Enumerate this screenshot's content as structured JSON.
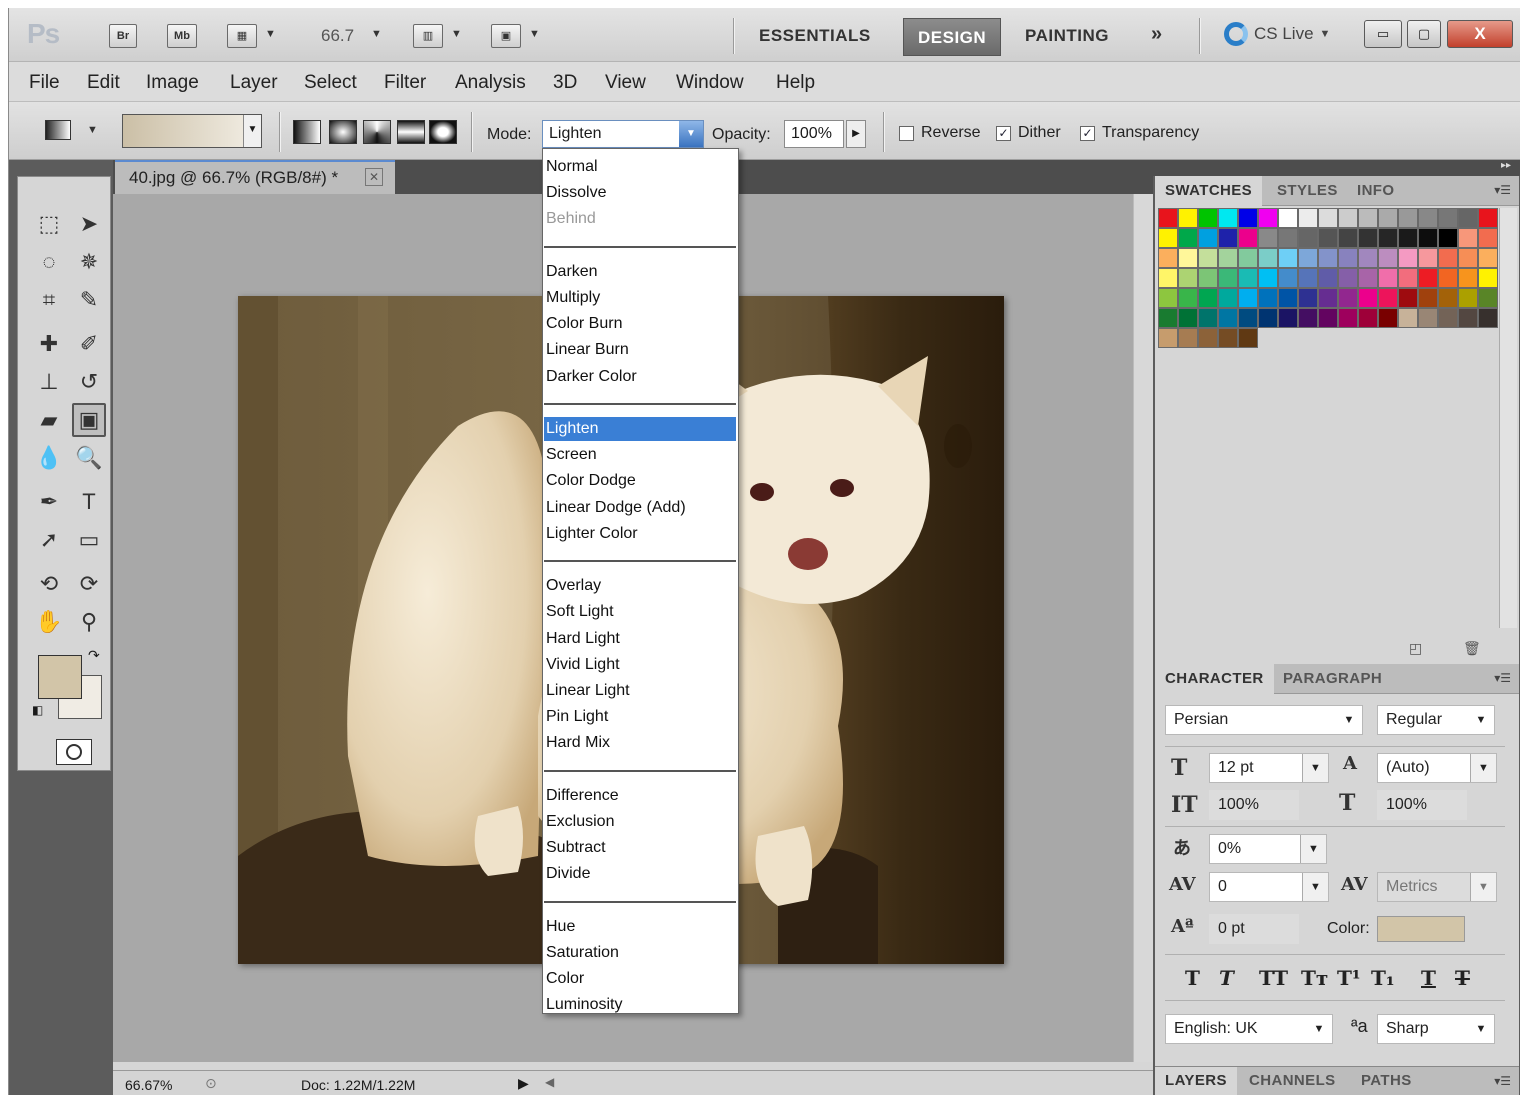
{
  "appbar": {
    "logo": "Ps",
    "bridge_label": "Br",
    "minibridge_label": "Mb",
    "zoom": "66.7",
    "workspaces": [
      "ESSENTIALS",
      "DESIGN",
      "PAINTING"
    ],
    "more_workspaces": "»",
    "cs_live": "CS Live",
    "min_glyph": "▭",
    "max_glyph": "▢",
    "close_glyph": "X"
  },
  "menus": [
    "File",
    "Edit",
    "Image",
    "Layer",
    "Select",
    "Filter",
    "Analysis",
    "3D",
    "View",
    "Window",
    "Help"
  ],
  "options": {
    "mode_label": "Mode:",
    "mode_value": "Lighten",
    "opacity_label": "Opacity:",
    "opacity_value": "100%",
    "reverse_label": "Reverse",
    "reverse_checked": false,
    "dither_label": "Dither",
    "dither_checked": true,
    "transparency_label": "Transparency",
    "transparency_checked": true,
    "check_glyph": "✓"
  },
  "document": {
    "tab_title": "40.jpg @ 66.7% (RGB/8#) *",
    "close_glyph": "✕",
    "status_zoom": "66.67%",
    "status_doc": "Doc: 1.22M/1.22M"
  },
  "blend_modes": {
    "selected": "Lighten",
    "groups": [
      [
        "Normal",
        "Dissolve",
        "Behind"
      ],
      [
        "Darken",
        "Multiply",
        "Color Burn",
        "Linear Burn",
        "Darker Color"
      ],
      [
        "Lighten",
        "Screen",
        "Color Dodge",
        "Linear Dodge (Add)",
        "Lighter Color"
      ],
      [
        "Overlay",
        "Soft Light",
        "Hard Light",
        "Vivid Light",
        "Linear Light",
        "Pin Light",
        "Hard Mix"
      ],
      [
        "Difference",
        "Exclusion",
        "Subtract",
        "Divide"
      ],
      [
        "Hue",
        "Saturation",
        "Color",
        "Luminosity"
      ]
    ],
    "disabled": [
      "Behind"
    ]
  },
  "tools": [
    "marquee-icon",
    "move-icon",
    "lasso-icon",
    "magic-wand-icon",
    "crop-icon",
    "eyedropper-icon",
    "healing-brush-icon",
    "brush-icon",
    "clone-stamp-icon",
    "history-brush-icon",
    "eraser-icon",
    "gradient-icon",
    "blur-icon",
    "dodge-icon",
    "pen-icon",
    "type-icon",
    "path-selection-icon",
    "rectangle-shape-icon",
    "3d-rotate-icon",
    "3d-orbit-icon",
    "hand-icon",
    "zoom-icon"
  ],
  "tool_glyphs": [
    "⬚",
    "➤",
    "◌",
    "✵",
    "⌗",
    "✎",
    "✚",
    "✐",
    "⊥",
    "↺",
    "▰",
    "▣",
    "💧",
    "🔍",
    "✒",
    "T",
    "➚",
    "▭",
    "⟲",
    "⟳",
    "✋",
    "⚲"
  ],
  "colors": {
    "foreground": "#d2c5a8",
    "background": "#f0ece4",
    "accent_selection": "#3a7fd5"
  },
  "swatches_panel": {
    "tabs": [
      "SWATCHES",
      "STYLES",
      "INFO"
    ],
    "rows": [
      [
        "#e8141c",
        "#fff200",
        "#00c400",
        "#00e8f0",
        "#0000e8",
        "#f000f0",
        "#ffffff",
        "#ececec",
        "#dcdcdc",
        "#cccccc",
        "#bbbbbb",
        "#aaaaaa",
        "#999999",
        "#888888",
        "#777777",
        "#666666",
        "#e8141c"
      ],
      [
        "#fff200",
        "#00a84a",
        "#00a0e0",
        "#1e22aa",
        "#ec008c",
        "#898989",
        "#777777",
        "#666666",
        "#555555",
        "#444444",
        "#333333",
        "#262626",
        "#1a1a1a",
        "#0d0d0d",
        "#000000",
        "#f7977a",
        "#f26c4f"
      ],
      [
        "#fbaf5d",
        "#fff79a",
        "#c4df9b",
        "#a3d39c",
        "#82ca9d",
        "#7bcdc8",
        "#6ecff6",
        "#7da7d9",
        "#8393ca",
        "#8882be",
        "#a187be",
        "#bc8dbf",
        "#f49ac2",
        "#f6989d",
        "#f26c4f",
        "#f68e56",
        "#fbaf5d"
      ],
      [
        "#fff568",
        "#acd372",
        "#7cc576",
        "#3bb878",
        "#1abbb4",
        "#00bff3",
        "#448ccb",
        "#5674b9",
        "#605ca8",
        "#855fa8",
        "#a864a8",
        "#f06eaa",
        "#f26d7d",
        "#ed1c24",
        "#f26522",
        "#f7941d",
        "#fff200"
      ],
      [
        "#8dc63f",
        "#39b54a",
        "#00a651",
        "#00a99d",
        "#00aeef",
        "#0072bc",
        "#0054a6",
        "#2e3192",
        "#662d91",
        "#92278f",
        "#ec008c",
        "#ed145b",
        "#9e0b0f",
        "#a0410d",
        "#a36209",
        "#aba000",
        "#598527"
      ],
      [
        "#197b30",
        "#007236",
        "#00746b",
        "#0076a3",
        "#004b80",
        "#003471",
        "#1b1464",
        "#440e62",
        "#630460",
        "#9e005d",
        "#9e0039",
        "#790000",
        "#c7b299",
        "#998675",
        "#736357",
        "#534741",
        "#37302d"
      ],
      [
        "#c69c6d",
        "#a67c52",
        "#8c6239",
        "#754c24",
        "#603913"
      ]
    ],
    "footer_glyphs": [
      "◰",
      "🗑"
    ]
  },
  "character_panel": {
    "tabs": [
      "CHARACTER",
      "PARAGRAPH"
    ],
    "font_family": "Persian",
    "font_style": "Regular",
    "font_size": "12 pt",
    "leading": "(Auto)",
    "vertical_scale": "100%",
    "horizontal_scale": "100%",
    "tsume": "0%",
    "kerning": "0",
    "tracking": "Metrics",
    "baseline_shift": "0 pt",
    "color_label": "Color:",
    "style_buttons": [
      "T",
      "T",
      "TT",
      "Tт",
      "T¹",
      "T₁",
      "T",
      "T"
    ],
    "language": "English: UK",
    "antialias_glyph": "ªa",
    "antialias": "Sharp"
  },
  "layers_panel": {
    "tabs": [
      "LAYERS",
      "CHANNELS",
      "PATHS"
    ]
  },
  "photo_alt": "albino raccoon"
}
